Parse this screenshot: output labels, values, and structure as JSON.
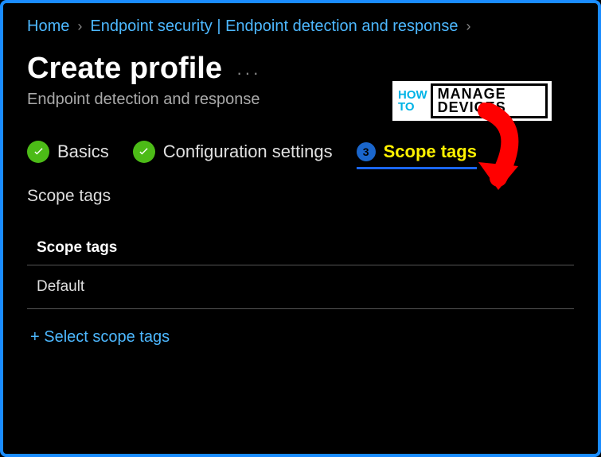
{
  "breadcrumb": {
    "home": "Home",
    "section": "Endpoint security | Endpoint detection and response"
  },
  "title": "Create profile",
  "subtitle": "Endpoint detection and response",
  "steps": {
    "basics": "Basics",
    "config": "Configuration settings",
    "scope_number": "3",
    "scope": "Scope tags"
  },
  "section_heading": "Scope tags",
  "table": {
    "header": "Scope tags",
    "rows": [
      "Default"
    ]
  },
  "add_link": "+  Select scope tags",
  "logo": {
    "how": "HOW",
    "to": "TO",
    "manage": "MANAGE",
    "devices": "DEVICES"
  }
}
